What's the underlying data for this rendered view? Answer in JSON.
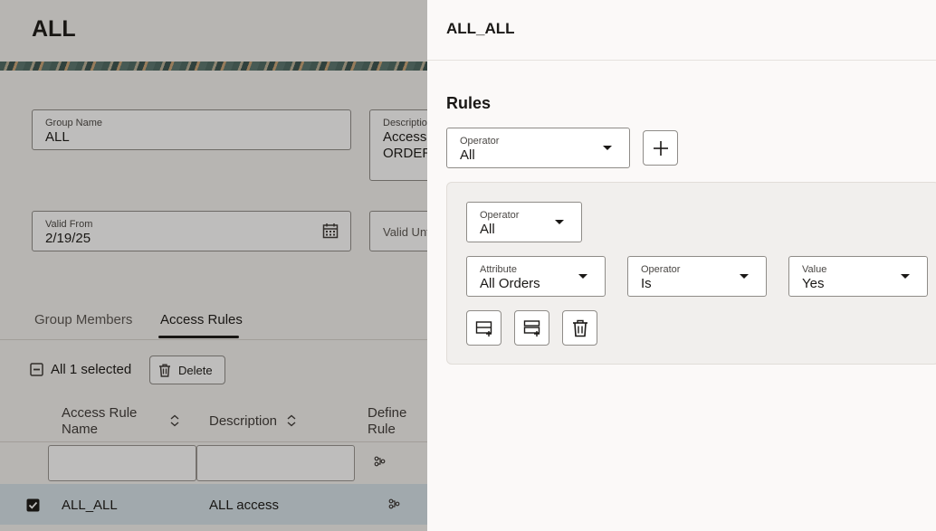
{
  "page": {
    "title": "ALL",
    "group_name": {
      "label": "Group Name",
      "value": "ALL"
    },
    "description": {
      "label": "Descriptio",
      "value_line1": "Access t",
      "value_line2": "ORDER_"
    },
    "valid_from": {
      "label": "Valid From",
      "value": "2/19/25"
    },
    "valid_until": {
      "label": "Valid Unt"
    },
    "tabs": [
      {
        "label": "Group Members"
      },
      {
        "label": "Access Rules"
      }
    ],
    "selection": {
      "label": "All 1 selected",
      "delete_label": "Delete"
    },
    "table": {
      "headers": {
        "name_line1": "Access Rule",
        "name_line2": "Name",
        "description": "Description",
        "define_line1": "Define",
        "define_line2": "Rule"
      },
      "rows": [
        {
          "name": "ALL_ALL",
          "description": "ALL access"
        }
      ]
    }
  },
  "drawer": {
    "title": "ALL_ALL",
    "rules_heading": "Rules",
    "top_operator": {
      "label": "Operator",
      "value": "All"
    },
    "group": {
      "operator": {
        "label": "Operator",
        "value": "All"
      },
      "attribute": {
        "label": "Attribute",
        "value": "All Orders"
      },
      "condition_operator": {
        "label": "Operator",
        "value": "Is"
      },
      "value": {
        "label": "Value",
        "value": "Yes"
      }
    }
  },
  "colors": {
    "page_bg": "#f6f4f2",
    "drawer_bg": "#fbf9f8",
    "group_bg": "#f1efed",
    "selected_row": "#d7e3ea",
    "text": "#1a1816"
  },
  "icons": [
    "calendar-icon",
    "plus-icon",
    "trash-icon",
    "add-condition-icon",
    "add-group-icon",
    "sort-icon",
    "define-rule-icon",
    "minus-checkbox-icon",
    "checked-checkbox-icon",
    "caret-down-icon"
  ]
}
